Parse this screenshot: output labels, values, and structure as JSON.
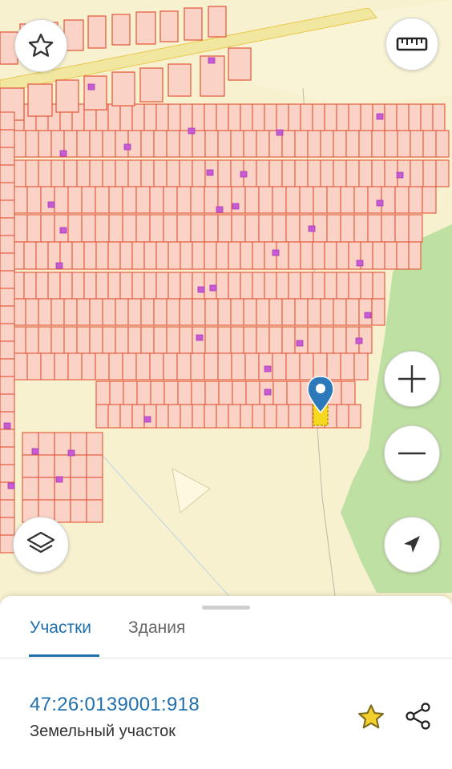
{
  "map": {
    "colors": {
      "background": "#f7f1cf",
      "parcel_fill": "#fbd3c6",
      "parcel_stroke": "#e2553a",
      "building": "#c75bd4",
      "forest": "#bfe0a3",
      "road": "#f2e7a0",
      "marker": "#2b79b8",
      "selected_parcel": "#f5d81f"
    },
    "buttons": {
      "favorite": "star-icon",
      "ruler": "ruler-icon",
      "zoom_in": "plus-icon",
      "zoom_out": "minus-icon",
      "layers": "layers-icon",
      "locate": "navigation-arrow-icon"
    }
  },
  "sheet": {
    "tabs": [
      {
        "label": "Участки",
        "active": true
      },
      {
        "label": "Здания",
        "active": false
      }
    ],
    "parcel": {
      "cadastral_number": "47:26:0139001:918",
      "type": "Земельный участок"
    }
  }
}
